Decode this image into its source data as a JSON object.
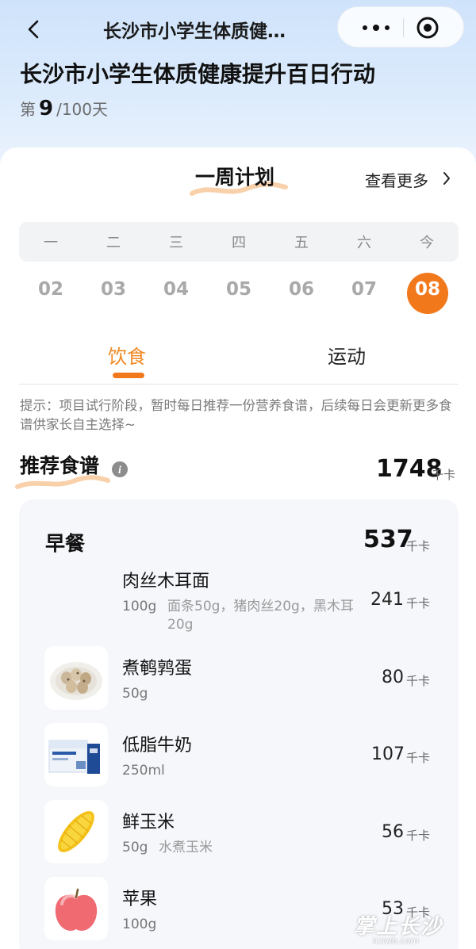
{
  "nav": {
    "title": "长沙市小学生体质健…",
    "back_icon": "chevron-left-icon",
    "more_icon": "more-dots-icon",
    "close_icon": "target-close-icon"
  },
  "header": {
    "title": "长沙市小学生体质健康提升百日行动",
    "day_prefix": "第",
    "day_number": "9",
    "day_suffix": "/100天"
  },
  "week_plan": {
    "title": "一周计划",
    "see_more": "查看更多",
    "weekdays": [
      "一",
      "二",
      "三",
      "四",
      "五",
      "六",
      "今"
    ],
    "dates": [
      "02",
      "03",
      "04",
      "05",
      "06",
      "07",
      "08"
    ],
    "selected_date": "08",
    "accent_color": "#f2781c"
  },
  "tabs": {
    "diet": "饮食",
    "exercise": "运动",
    "active": "饮食"
  },
  "tip": "提示：项目试行阶段，暂时每日推荐一份营养食谱，后续每日会更新更多食谱供家长自主选择~",
  "recipe": {
    "title": "推荐食谱",
    "total_kcal": "1748",
    "unit": "千卡"
  },
  "meal": {
    "name": "早餐",
    "kcal": "537",
    "unit": "千卡",
    "foods": [
      {
        "name": "肉丝木耳面",
        "qty": "100g",
        "note": "面条50g，猪肉丝20g，黑木耳20g",
        "kcal": "241",
        "unit": "千卡"
      },
      {
        "name": "煮鹌鹑蛋",
        "qty": "50g",
        "note": "",
        "kcal": "80",
        "unit": "千卡"
      },
      {
        "name": "低脂牛奶",
        "qty": "250ml",
        "note": "",
        "kcal": "107",
        "unit": "千卡"
      },
      {
        "name": "鲜玉米",
        "qty": "50g",
        "note": "水煮玉米",
        "kcal": "56",
        "unit": "千卡"
      },
      {
        "name": "苹果",
        "qty": "100g",
        "note": "",
        "kcal": "53",
        "unit": "千卡"
      }
    ]
  },
  "watermark": {
    "text": "掌上长沙",
    "sub": "icswb.com"
  }
}
